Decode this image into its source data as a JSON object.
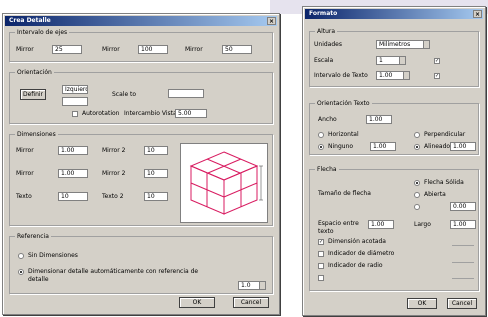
{
  "left": {
    "title": "Crea Detalle",
    "close": "×",
    "g1": {
      "title": "Intervalo de ejes",
      "r1_label": "Mirror",
      "r1_value": "25",
      "r2_label": "Mirror",
      "r2_value": "100",
      "r3_label": "Mirror",
      "r3_value": "50"
    },
    "g2": {
      "title": "Orientación",
      "btn_a": "Definir",
      "btn_b": "Izquierda",
      "lbl_a": "Scale to",
      "val_a": "",
      "lbl_b": "Autorotation",
      "lbl_c": "Intercambio Vistas",
      "val_c": "5.00"
    },
    "g3": {
      "title": "Dimensiones",
      "rows": [
        {
          "l1": "Mirror",
          "v1": "1.00",
          "l2": "Mirror 2",
          "v2": "10"
        },
        {
          "l1": "Mirror",
          "v1": "1.00",
          "l2": "Mirror 2",
          "v2": "10"
        },
        {
          "l1": "Texto",
          "v1": "10",
          "l2": "Texto 2",
          "v2": "10"
        }
      ]
    },
    "g4": {
      "title": "Referencia",
      "opt1": "Sin Dimensiones",
      "opt2": "Dimensionar detalle automáticamente con referencia de detalle",
      "val": "1.0"
    },
    "ok": "OK",
    "cancel": "Cancel"
  },
  "right": {
    "title": "Formato",
    "close": "×",
    "g1": {
      "title": "Altura",
      "lbl1": "Unidades",
      "val1": "Milímetros",
      "lbl2": "Escala",
      "val2": "1",
      "lbl3": "Intervalo de Texto",
      "val3": "1.00"
    },
    "g2": {
      "title": "Orientación Texto",
      "lbl1": "Ancho",
      "val1": "1.00",
      "opt1": "Horizontal",
      "opt2": "Perpendicular",
      "opt3": "Ninguno",
      "val2": "1.00",
      "opt4": "Alineado",
      "val3": "1.00"
    },
    "g3": {
      "title": "Flecha",
      "lbl1": "Tamaño de flecha",
      "lbl2": "Flecha Sólida",
      "lbl3": "Abierta",
      "val1": "0.00",
      "lbl4": "Espacio entre texto",
      "val2": "1.00",
      "lbl5": "Largo",
      "val3": "1.00",
      "chk1": "Dimensión acotada",
      "chk2": "Indicador de diámetro",
      "chk3": "Indicador de radio"
    },
    "ok": "OK",
    "cancel": "Cancel"
  },
  "colors": {
    "title_start": "#0a246a",
    "title_end": "#a6caf0",
    "face": "#d4d0c8",
    "cube": "#d81b60"
  }
}
